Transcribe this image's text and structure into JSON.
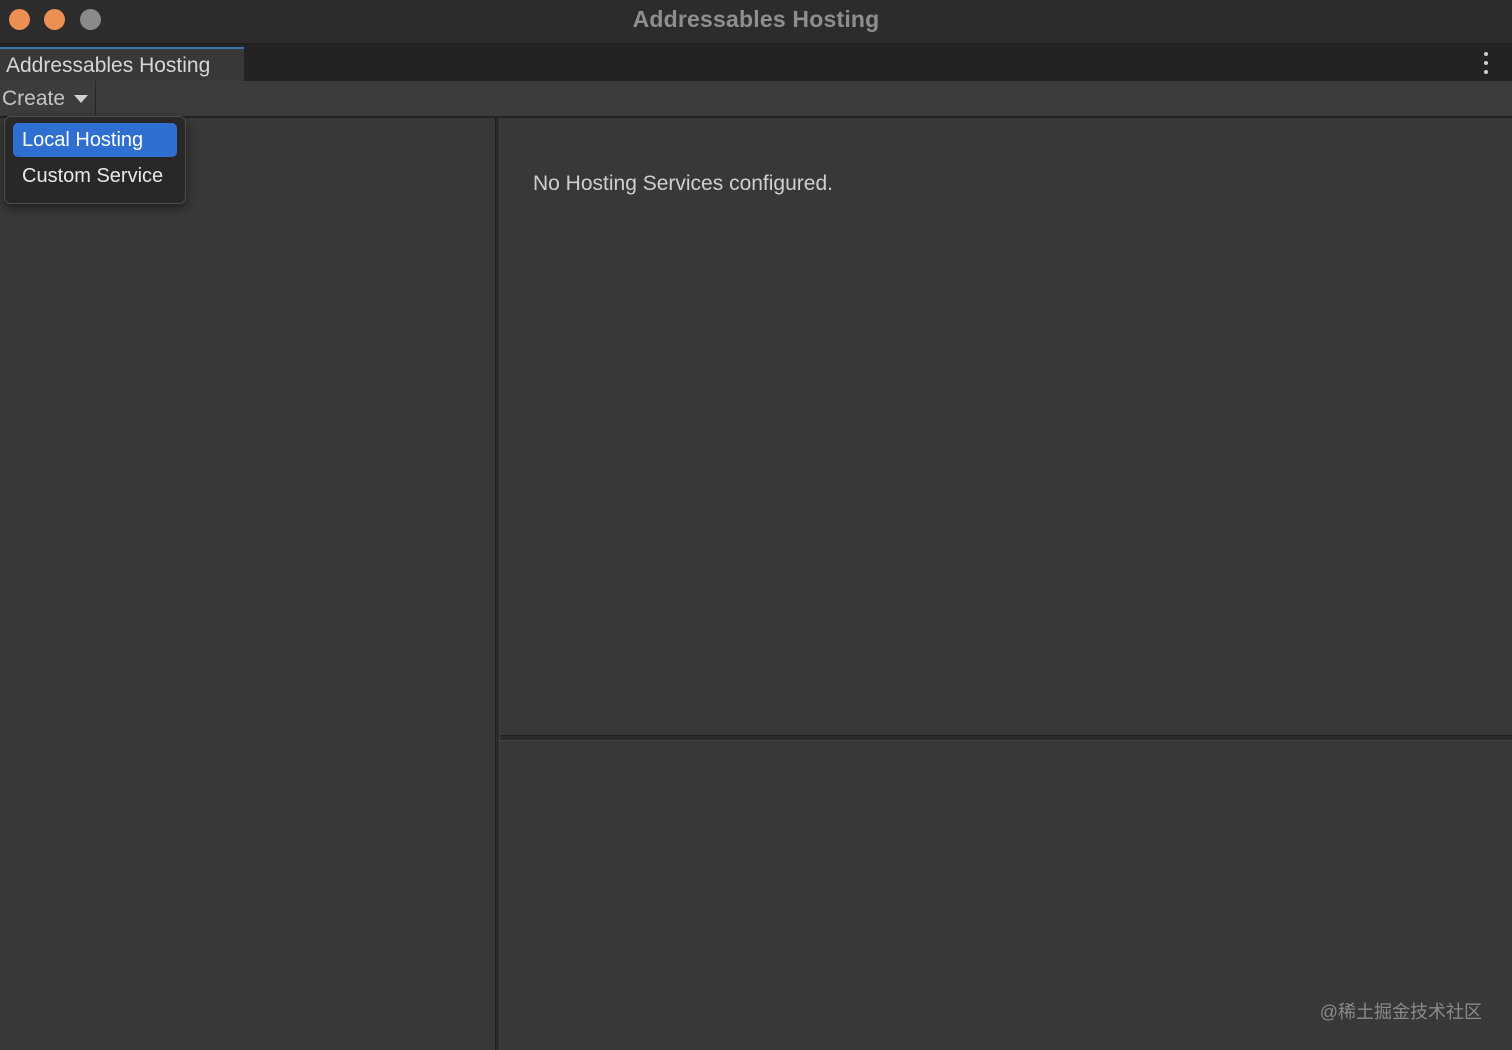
{
  "window": {
    "title": "Addressables Hosting",
    "traffic_colors": {
      "close": "#ec8f52",
      "minimize": "#ec8f52",
      "zoom": "#8a8a8a"
    }
  },
  "tabs": [
    {
      "label": "Addressables Hosting",
      "active": true
    }
  ],
  "toolbar": {
    "create_label": "Create"
  },
  "dropdown": {
    "items": [
      {
        "label": "Local Hosting",
        "selected": true
      },
      {
        "label": "Custom Service",
        "selected": false
      }
    ],
    "highlight_color": "#2f6fd1"
  },
  "main": {
    "empty_message": "No Hosting Services configured."
  },
  "watermark": "@稀土掘金技术社区"
}
